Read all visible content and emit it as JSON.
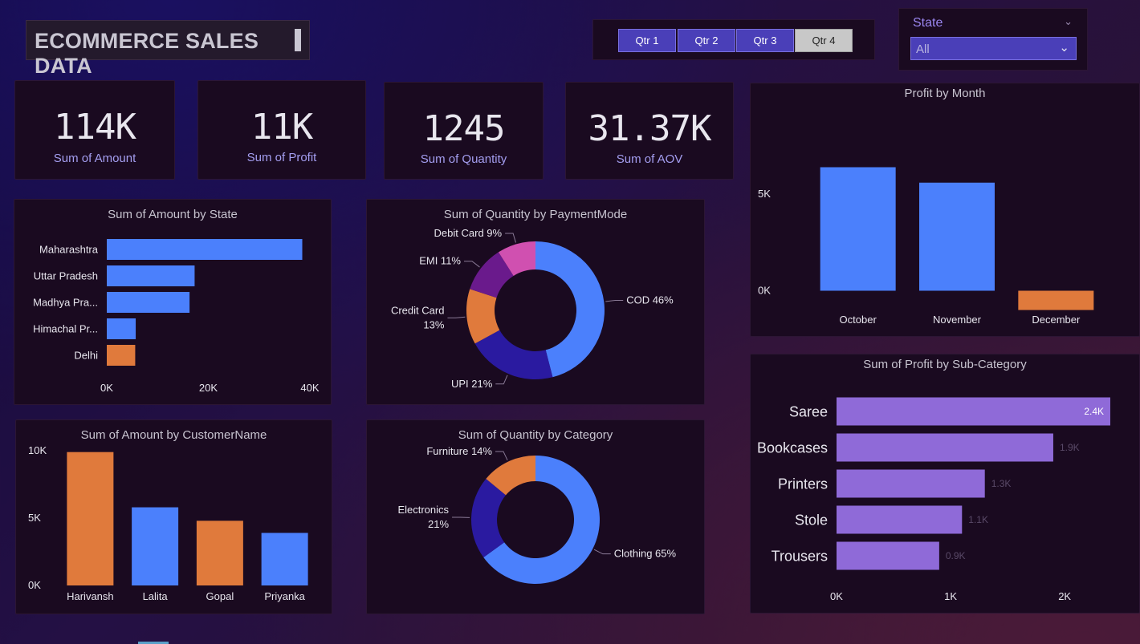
{
  "header": {
    "title": "ECOMMERCE SALES DATA"
  },
  "quarters": {
    "items": [
      "Qtr 1",
      "Qtr 2",
      "Qtr 3",
      "Qtr 4"
    ],
    "selected": "Qtr 4"
  },
  "state_filter": {
    "label": "State",
    "value": "All"
  },
  "kpis": [
    {
      "value": "114K",
      "label": "Sum of Amount"
    },
    {
      "value": "11K",
      "label": "Sum of Profit"
    },
    {
      "value": "1245",
      "label": "Sum of Quantity"
    },
    {
      "value": "31.37K",
      "label": "Sum of AOV"
    }
  ],
  "colors": {
    "blue": "#4b80fc",
    "orange": "#e07a3c",
    "purple": "#8f6ad8",
    "navy": "#2a1aa0",
    "violet": "#6a1a8c",
    "pink": "#d050b0",
    "axis_text": "#e8e6ee"
  },
  "chart_data": [
    {
      "id": "amount_by_state",
      "type": "bar",
      "orientation": "horizontal",
      "title": "Sum of Amount by State",
      "categories": [
        "Maharashtra",
        "Uttar Pradesh",
        "Madhya Pra...",
        "Himachal Pr...",
        "Delhi"
      ],
      "values": [
        38500,
        17300,
        16300,
        5700,
        5600
      ],
      "bar_colors": [
        "blue",
        "blue",
        "blue",
        "blue",
        "orange"
      ],
      "xlim": [
        0,
        40000
      ],
      "ticks": [
        {
          "v": 0,
          "label": "0K"
        },
        {
          "v": 20000,
          "label": "20K"
        },
        {
          "v": 40000,
          "label": "40K"
        }
      ]
    },
    {
      "id": "quantity_by_paymentmode",
      "type": "pie",
      "donut": true,
      "title": "Sum of Quantity by PaymentMode",
      "slices": [
        {
          "label": "COD 46%",
          "value": 46,
          "color": "#4b80fc"
        },
        {
          "label": "UPI 21%",
          "value": 21,
          "color": "#2a1aa0"
        },
        {
          "label": "Credit Card 13%",
          "value": 13,
          "color": "#e07a3c"
        },
        {
          "label": "EMI 11%",
          "value": 11,
          "color": "#6a1a8c"
        },
        {
          "label": "Debit Card 9%",
          "value": 9,
          "color": "#d050b0"
        }
      ]
    },
    {
      "id": "profit_by_month",
      "type": "bar",
      "title": "Profit by Month",
      "categories": [
        "October",
        "November",
        "December"
      ],
      "values": [
        6400,
        5600,
        -1000
      ],
      "bar_colors": [
        "blue",
        "blue",
        "orange"
      ],
      "ylim": [
        -1600,
        8000
      ],
      "ticks": [
        {
          "v": 0,
          "label": "0K"
        },
        {
          "v": 5000,
          "label": "5K"
        }
      ]
    },
    {
      "id": "amount_by_customername",
      "type": "bar",
      "title": "Sum of Amount by CustomerName",
      "categories": [
        "Harivansh",
        "Lalita",
        "Gopal",
        "Priyanka"
      ],
      "values": [
        9900,
        5800,
        4800,
        3900
      ],
      "bar_colors": [
        "orange",
        "blue",
        "orange",
        "blue"
      ],
      "ylim": [
        0,
        10000
      ],
      "ticks": [
        {
          "v": 0,
          "label": "0K"
        },
        {
          "v": 5000,
          "label": "5K"
        },
        {
          "v": 10000,
          "label": "10K"
        }
      ]
    },
    {
      "id": "quantity_by_category",
      "type": "pie",
      "donut": true,
      "title": "Sum of Quantity by Category",
      "slices": [
        {
          "label": "Clothing 65%",
          "value": 65,
          "color": "#4b80fc"
        },
        {
          "label": "Electronics 21%",
          "value": 21,
          "color": "#2a1aa0"
        },
        {
          "label": "Furniture 14%",
          "value": 14,
          "color": "#e07a3c"
        }
      ]
    },
    {
      "id": "profit_by_subcategory",
      "type": "bar",
      "orientation": "horizontal",
      "title": "Sum of Profit by Sub-Category",
      "categories": [
        "Saree",
        "Bookcases",
        "Printers",
        "Stole",
        "Trousers"
      ],
      "values": [
        2400,
        1900,
        1300,
        1100,
        900
      ],
      "value_labels": [
        "2.4K",
        "1.9K",
        "1.3K",
        "1.1K",
        "0.9K"
      ],
      "bar_colors": [
        "purple",
        "purple",
        "purple",
        "purple",
        "purple"
      ],
      "xlim": [
        0,
        2400
      ],
      "ticks": [
        {
          "v": 0,
          "label": "0K"
        },
        {
          "v": 1000,
          "label": "1K"
        },
        {
          "v": 2000,
          "label": "2K"
        }
      ]
    }
  ]
}
